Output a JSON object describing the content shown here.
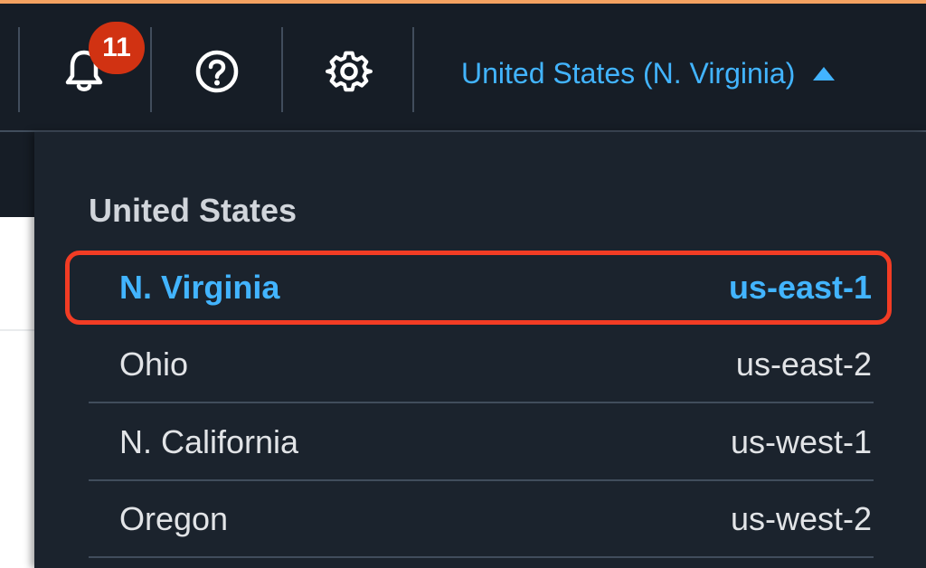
{
  "colors": {
    "accent_bar": "#f4a261",
    "nav_bg": "#161d26",
    "dropdown_bg": "#1b232d",
    "link_blue": "#42b4ff",
    "badge_red": "#d13212",
    "highlight_red": "#f23c24"
  },
  "header": {
    "notifications": {
      "icon": "bell-icon",
      "count": "11"
    },
    "help": {
      "icon": "help-circle-icon"
    },
    "settings": {
      "icon": "gear-icon"
    },
    "region_selector": {
      "label": "United States (N. Virginia)",
      "icon": "caret-up-icon"
    }
  },
  "region_menu": {
    "group_title": "United States",
    "regions": [
      {
        "name": "N. Virginia",
        "code": "us-east-1",
        "selected": true
      },
      {
        "name": "Ohio",
        "code": "us-east-2",
        "selected": false
      },
      {
        "name": "N. California",
        "code": "us-west-1",
        "selected": false
      },
      {
        "name": "Oregon",
        "code": "us-west-2",
        "selected": false
      }
    ]
  }
}
